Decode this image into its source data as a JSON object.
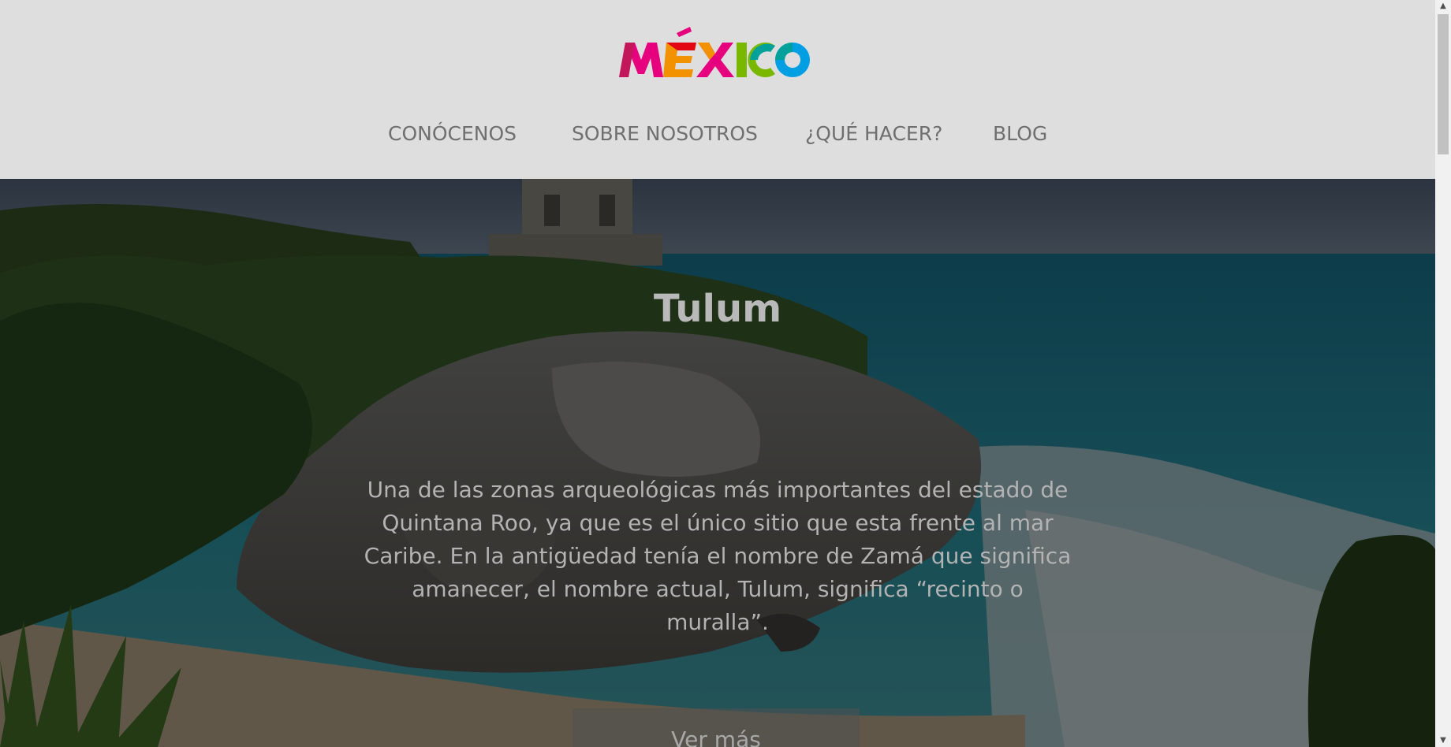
{
  "logo": {
    "text": "MÉXICO",
    "icon": "mexico-brand-logo",
    "colors": [
      "#e6007e",
      "#f39200",
      "#e30613",
      "#7ab800",
      "#009fe3",
      "#00a19a"
    ]
  },
  "nav": {
    "items": [
      {
        "label": "CONÓCENOS"
      },
      {
        "label": "SOBRE NOSOTROS"
      },
      {
        "label": "¿QUÉ HACER?"
      },
      {
        "label": "BLOG"
      }
    ]
  },
  "hero": {
    "title": "Tulum",
    "description": "Una de las zonas arqueológicas más importantes del estado de Quintana Roo, ya que es el único sitio que esta frente al mar Caribe. En la antigüedad tenía el nombre de Zamá que significa amanecer, el nombre actual, Tulum, significa “recinto o muralla”.",
    "cta_label": "Ver más"
  },
  "scrollbar": {
    "up_icon": "triangle-up",
    "down_icon": "triangle-down"
  }
}
